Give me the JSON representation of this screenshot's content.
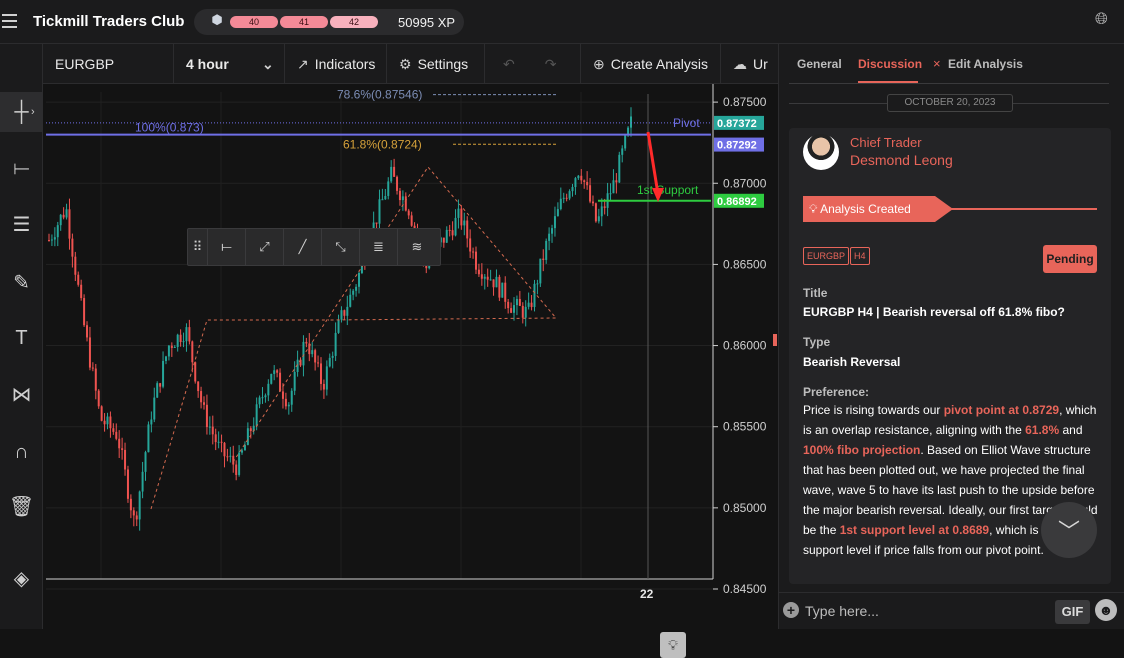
{
  "app": {
    "title": "Tickmill Traders Club",
    "xp_levels": [
      "40",
      "41",
      "42"
    ],
    "xp": "50995 XP"
  },
  "toolbar": {
    "symbol": "EURGBP",
    "timeframe": "4 hour",
    "indicators": "Indicators",
    "settings": "Settings",
    "create_analysis": "Create Analysis",
    "cut_label": "Ur"
  },
  "lefttools": [
    "crosshair-icon",
    "line-icon",
    "fib-icon",
    "brush-icon",
    "text-icon",
    "pattern-icon",
    "magnet-icon",
    "trash-icon",
    "layers-icon"
  ],
  "chart_data": {
    "type": "candlestick",
    "symbol": "EURGBP",
    "timeframe": "4 hour",
    "ylim": [
      0.845,
      0.8755
    ],
    "y_ticks": [
      "0.87500",
      "0.87000",
      "0.86500",
      "0.86000",
      "0.85500",
      "0.85000",
      "0.84500"
    ],
    "x_ticks": [
      "22"
    ],
    "price_path": [
      0.8665,
      0.8685,
      0.8615,
      0.8555,
      0.8545,
      0.849,
      0.856,
      0.86,
      0.861,
      0.856,
      0.8535,
      0.8525,
      0.8555,
      0.8585,
      0.8565,
      0.8605,
      0.8575,
      0.8615,
      0.864,
      0.8675,
      0.8705,
      0.8685,
      0.865,
      0.8665,
      0.868,
      0.865,
      0.864,
      0.8625,
      0.862,
      0.866,
      0.869,
      0.871,
      0.8675,
      0.87,
      0.8737
    ],
    "levels": [
      {
        "label": "100%(0.873)",
        "value": 0.873,
        "color": "#6f6fe6"
      },
      {
        "label": "78.6%(0.87546)",
        "value": 0.87546,
        "color": "#7c8db5"
      },
      {
        "label": "61.8%(0.8724)",
        "value": 0.8724,
        "color": "#d6a13a"
      },
      {
        "label": "Pivot",
        "value": 0.87372,
        "color": "#6f6fe6"
      },
      {
        "label": "1st Support",
        "value": 0.86892,
        "color": "#2ecc40"
      }
    ],
    "price_tags": [
      {
        "text": "0.87372",
        "color": "#26a69a"
      },
      {
        "text": "0.87292",
        "color": "#6f6fe6"
      },
      {
        "text": "0.86892",
        "color": "#2ecc40"
      }
    ]
  },
  "panel": {
    "tabs": [
      "General",
      "Discussion",
      "Edit Analysis"
    ],
    "close": "×",
    "date": "OCTOBER 20, 2023",
    "author_role": "Chief Trader",
    "author_name": "Desmond Leong",
    "status": "Analysis Created",
    "tags": [
      "EURGBP",
      "H4"
    ],
    "badge": "Pending",
    "title_label": "Title",
    "title_value": "EURGBP H4 | Bearish reversal off 61.8% fibo?",
    "type_label": "Type",
    "type_value": "Bearish Reversal",
    "pref_label": "Preference:",
    "body": [
      {
        "t": "Price is rising towards our ",
        "h": false
      },
      {
        "t": "pivot point at 0.8729",
        "h": true
      },
      {
        "t": ", which is an overlap resistance, aligning with the ",
        "h": false
      },
      {
        "t": "61.8%",
        "h": true
      },
      {
        "t": " and ",
        "h": false
      },
      {
        "t": "100% fibo projection",
        "h": true
      },
      {
        "t": ". Based on Elliot Wave structure that has been plotted out, we have projected the final wave, wave 5 to have its last push to the upside before the major bearish reversal. Ideally, our first target would be the ",
        "h": false
      },
      {
        "t": "1st support level at 0.8689",
        "h": true
      },
      {
        "t": ", which is a pullback support level if price falls from our pivot point.",
        "h": false
      }
    ],
    "composer_placeholder": "Type here...",
    "gif": "GIF"
  }
}
